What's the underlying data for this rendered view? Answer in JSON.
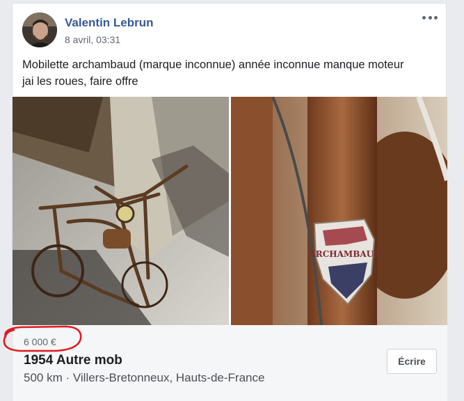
{
  "post": {
    "author": "Valentin Lebrun",
    "timestamp": "8 avril, 03:31",
    "text_line1": "Mobilette archambaud (marque inconnue) année inconnue manque moteur",
    "text_line2": "jai les roues, faire offre"
  },
  "photos": {
    "left": "moped-frame-photo",
    "right": "archambaud-badge-photo",
    "badge_text": "ARCHAMBAUD"
  },
  "listing": {
    "price": "6 000 €",
    "title": "1954 Autre mob",
    "location": "500 km · Villers-Bretonneux, Hauts-de-France",
    "write_button": "Écrire"
  },
  "colors": {
    "link": "#385898",
    "annotation_circle": "#e0191f",
    "listing_bg": "#f5f6f7"
  }
}
